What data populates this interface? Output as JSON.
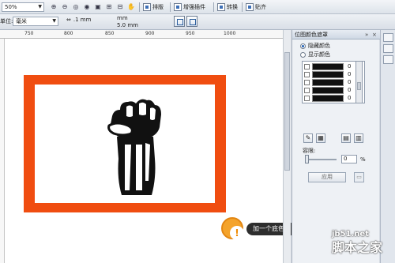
{
  "toolbar": {
    "zoom_value": "50%",
    "arrange_label": "排版",
    "enhance_plugin_label": "增强插件",
    "convert_label": "转换",
    "paste_label": "贴齐"
  },
  "property_bar": {
    "unit_label": "单位:",
    "unit_value": "毫米",
    "nudge_value": ".1 mm",
    "dup_x": "mm",
    "dup_y": "5.0 mm"
  },
  "ruler": {
    "ticks": [
      "750",
      "800",
      "850",
      "900",
      "950",
      "1000"
    ]
  },
  "tip": {
    "icon": "!",
    "label": "加一个底色"
  },
  "panel": {
    "title": "位图颜色遮罩",
    "option_hide": "隐藏颜色",
    "option_show": "显示颜色",
    "selected_option": "隐藏颜色",
    "color_rows": [
      {
        "color": "#111111",
        "value": "0"
      },
      {
        "color": "#111111",
        "value": "0"
      },
      {
        "color": "#111111",
        "value": "0"
      },
      {
        "color": "#111111",
        "value": "0"
      },
      {
        "color": "#111111",
        "value": "0"
      }
    ],
    "tolerance_label": "容限:",
    "tolerance_value": "0",
    "tolerance_unit": "%",
    "apply_label": "应用"
  },
  "watermark": {
    "site": "jb51.net",
    "name": "脚本之家"
  },
  "colors": {
    "frame": "#f04d10",
    "tip_orange": "#f4a32b",
    "tip_dark": "#2e2e2e"
  }
}
